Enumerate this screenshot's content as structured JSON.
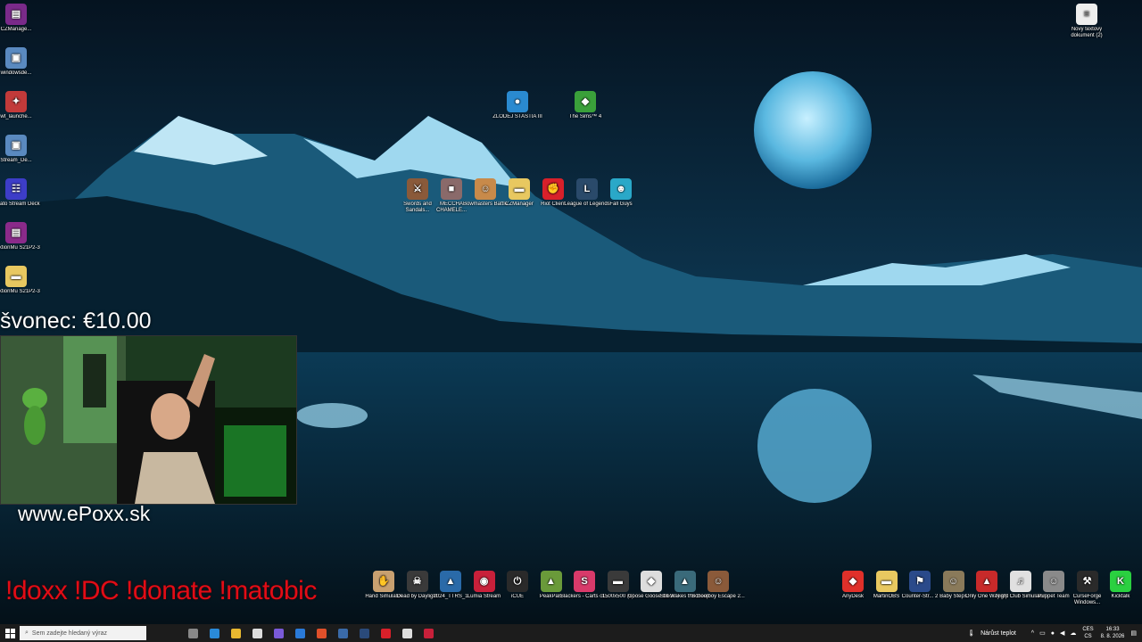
{
  "desktop": {
    "icons_left": [
      {
        "label": "CZManage...",
        "color": "#7a2a8a",
        "glyph": "▤"
      },
      {
        "label": "windowsde...",
        "color": "#5a8ac0",
        "glyph": "▣"
      },
      {
        "label": "wt_launche...",
        "color": "#c23a3a",
        "glyph": "✦"
      },
      {
        "label": "Stream_De...",
        "color": "#5a8ac0",
        "glyph": "▣"
      },
      {
        "label": "Elgato Stream Deck",
        "color": "#3d3dc8",
        "glyph": "☷"
      },
      {
        "label": "RaktionMu S21P2-3",
        "color": "#8a2a8a",
        "glyph": "▤"
      },
      {
        "label": "RaktionMu S21P2-3",
        "color": "#e8c860",
        "glyph": "▬"
      }
    ],
    "icons_top": [
      {
        "label": "ZLODEJ STASTIA III",
        "color": "#2a8ad0",
        "glyph": "●"
      },
      {
        "label": "The Sims™ 4",
        "color": "#3aa03a",
        "glyph": "◆"
      }
    ],
    "icons_row": [
      {
        "label": "Swords and Sandals...",
        "color": "#8a5a3a",
        "glyph": "⚔"
      },
      {
        "label": "MECCHA CHAMELE...",
        "color": "#8a6a6a",
        "glyph": "■"
      },
      {
        "label": "Bowmasters Battle",
        "color": "#c88a4a",
        "glyph": "☺"
      },
      {
        "label": "CZManager",
        "color": "#e8c860",
        "glyph": "▬"
      },
      {
        "label": "Riot Client",
        "color": "#d8202a",
        "glyph": "✊"
      },
      {
        "label": "League of Legends",
        "color": "#2a4a6a",
        "glyph": "L"
      },
      {
        "label": "Fall Guys",
        "color": "#2aa8c8",
        "glyph": "☻"
      }
    ],
    "icon_topright": {
      "label": "Nový textový dokument (2)",
      "color": "#eeeeee",
      "glyph": "≡"
    },
    "icons_bottom": [
      {
        "label": "Hand Simulator",
        "color": "#c8a070",
        "glyph": "✋"
      },
      {
        "label": "Dead by Daylight",
        "color": "#3a3a3a",
        "glyph": "☠"
      },
      {
        "label": "2024_TTRS_1",
        "color": "#2a6aa8",
        "glyph": "▲"
      },
      {
        "label": "Lumia Stream",
        "color": "#c8203a",
        "glyph": "◉"
      },
      {
        "label": "iCUE",
        "color": "#2a2a2a",
        "glyph": "⏻"
      },
      {
        "label": "PeakPals",
        "color": "#6a9a3a",
        "glyph": "▲"
      },
      {
        "label": "Slackers - Carts of...",
        "color": "#d83a6a",
        "glyph": "S"
      },
      {
        "label": "1500x500 (1)",
        "color": "#3a3a3a",
        "glyph": "▬"
      },
      {
        "label": "Goose Goose Duck",
        "color": "#dddddd",
        "glyph": "◆"
      },
      {
        "label": "Still Wakes the Deep",
        "color": "#3a6a7a",
        "glyph": "▲"
      },
      {
        "label": "Schoolboy Escape 2...",
        "color": "#8a5a3a",
        "glyph": "☺"
      }
    ],
    "icons_bottom_right": [
      {
        "label": "AnyDesk",
        "color": "#e0302a",
        "glyph": "◆"
      },
      {
        "label": "MartinOBS",
        "color": "#e8c860",
        "glyph": "▬"
      },
      {
        "label": "Counter-Str... 2",
        "color": "#2a4a8a",
        "glyph": "⚑"
      },
      {
        "label": "Baby Steps",
        "color": "#8a7a5a",
        "glyph": "☺"
      },
      {
        "label": "Only One Way Up",
        "color": "#c82a2a",
        "glyph": "▲"
      },
      {
        "label": "Night Club Simulator",
        "color": "#e0e0e0",
        "glyph": "♫"
      },
      {
        "label": "Puppet Team",
        "color": "#8a8a8a",
        "glyph": "☺"
      },
      {
        "label": "CurseForge Windows...",
        "color": "#2a2a2a",
        "glyph": "⚒"
      },
      {
        "label": "Kicktalk",
        "color": "#2ad040",
        "glyph": "K"
      }
    ]
  },
  "overlays": {
    "donation": "švonec: €10.00",
    "url": "www.ePoxx.sk",
    "commands": "!doxx  !DC !donate !matobic"
  },
  "taskbar": {
    "search_placeholder": "Sem zadejte hledaný výraz",
    "apps": [
      {
        "name": "task-view",
        "color": "#888888"
      },
      {
        "name": "edge",
        "color": "#2a8ad8"
      },
      {
        "name": "file-explorer",
        "color": "#e8b830"
      },
      {
        "name": "store",
        "color": "#dddddd"
      },
      {
        "name": "copilot",
        "color": "#7a5ad8"
      },
      {
        "name": "mail",
        "color": "#2a7ad8"
      },
      {
        "name": "brave",
        "color": "#e0502a"
      },
      {
        "name": "app-blue",
        "color": "#3a6aa8"
      },
      {
        "name": "steam",
        "color": "#2a4a7a"
      },
      {
        "name": "riot",
        "color": "#d8202a"
      },
      {
        "name": "obs",
        "color": "#dddddd"
      },
      {
        "name": "lumia",
        "color": "#c8203a"
      }
    ],
    "weather": "Nárůst teplot",
    "lang_top": "CES",
    "lang_bottom": "CS",
    "time": "16:33",
    "date": "8. 8. 2026"
  },
  "colors": {
    "accent_red": "#e20c16",
    "taskbar": "#1c1c1c"
  }
}
